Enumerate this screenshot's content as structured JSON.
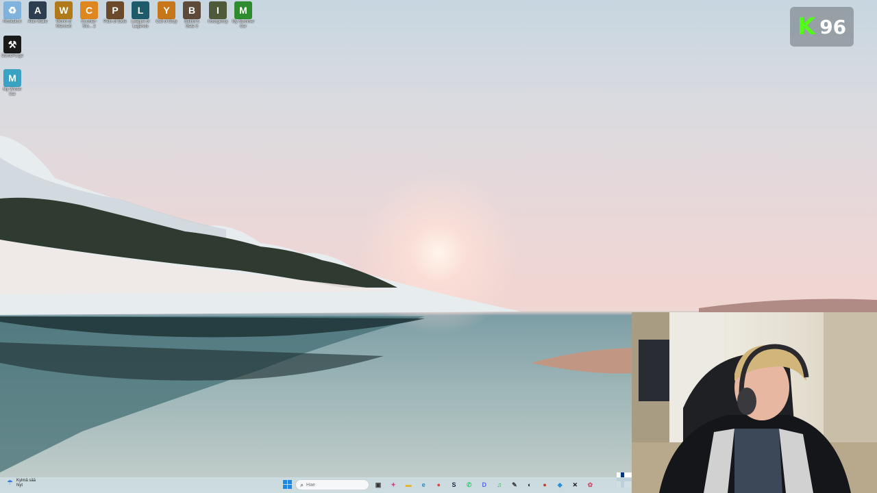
{
  "desktop": {
    "icons": [
      {
        "name": "recycle-bin-icon",
        "label": "Roskakori",
        "color": "#7fb2dc",
        "glyph": "♻"
      },
      {
        "name": "alan-wake-icon",
        "label": "Alan Wake",
        "color": "#2c3e50",
        "glyph": "A"
      },
      {
        "name": "world-of-warcraft-icon",
        "label": "World of Warcraft",
        "color": "#b07a1a",
        "glyph": "W"
      },
      {
        "name": "counter-strike-icon",
        "label": "Counter-Stri... 2",
        "color": "#e0861e",
        "glyph": "C"
      },
      {
        "name": "path-of-exile-icon",
        "label": "Path of Exile",
        "color": "#6b4a2b",
        "glyph": "P"
      },
      {
        "name": "league-of-legends-icon",
        "label": "League of Legends",
        "color": "#1d5a6a",
        "glyph": "L"
      },
      {
        "name": "call-of-duty-icon",
        "label": "Call of Duty",
        "color": "#c8761a",
        "glyph": "Y"
      },
      {
        "name": "baldurs-gate-icon",
        "label": "Baldur's Gate 3",
        "color": "#5e4a3a",
        "glyph": "B"
      },
      {
        "name": "insurgency-icon",
        "label": "Insurgency",
        "color": "#4f5a3b",
        "glyph": "I"
      },
      {
        "name": "my-summer-car-icon",
        "label": "My Summer Car",
        "color": "#2e8b2e",
        "glyph": "M"
      },
      {
        "name": "curseforge-icon",
        "label": "CurseForge",
        "color": "#1a1a1a",
        "glyph": "⚒"
      },
      {
        "name": "my-winter-car-icon",
        "label": "My Winter Car",
        "color": "#3aa3c4",
        "glyph": "M"
      }
    ]
  },
  "badge": {
    "platform_letter": "K",
    "viewer_count": "96"
  },
  "taskbar": {
    "weather_label": "Kylmä sää",
    "weather_sub": "Nyt",
    "search_placeholder": "Hae",
    "apps": [
      {
        "name": "task-view-icon",
        "glyph": "▣",
        "color": "#333333"
      },
      {
        "name": "copilot-icon",
        "glyph": "✦",
        "color": "#e0408a"
      },
      {
        "name": "file-explorer-icon",
        "glyph": "▬",
        "color": "#e6b422"
      },
      {
        "name": "edge-icon",
        "glyph": "e",
        "color": "#1f88d0"
      },
      {
        "name": "chrome-icon",
        "glyph": "●",
        "color": "#db4437"
      },
      {
        "name": "steam-icon",
        "glyph": "S",
        "color": "#1b2838"
      },
      {
        "name": "whatsapp-icon",
        "glyph": "✆",
        "color": "#25d366"
      },
      {
        "name": "discord-icon",
        "glyph": "D",
        "color": "#5865f2"
      },
      {
        "name": "spotify-icon",
        "glyph": "♫",
        "color": "#1db954"
      },
      {
        "name": "app-icon-1",
        "glyph": "✎",
        "color": "#333333"
      },
      {
        "name": "app-icon-2",
        "glyph": "◐",
        "color": "#222222"
      },
      {
        "name": "app-icon-3",
        "glyph": "●",
        "color": "#c0392b"
      },
      {
        "name": "app-icon-4",
        "glyph": "◆",
        "color": "#2a8fd8"
      },
      {
        "name": "app-icon-5",
        "glyph": "✕",
        "color": "#111111"
      },
      {
        "name": "app-icon-6",
        "glyph": "✿",
        "color": "#d14f6b"
      }
    ]
  }
}
